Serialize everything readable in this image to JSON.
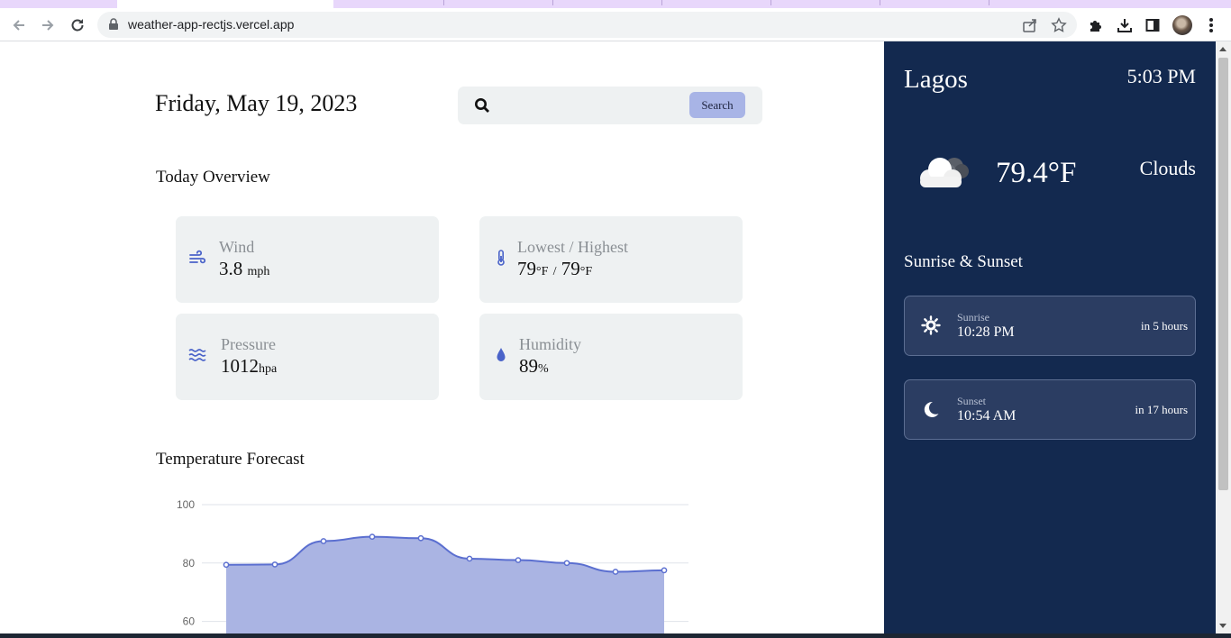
{
  "browser": {
    "url": "weather-app-rectjs.vercel.app"
  },
  "main": {
    "date": "Friday, May 19, 2023",
    "search": {
      "placeholder": "",
      "button_label": "Search"
    },
    "today_overview_title": "Today Overview",
    "cards": {
      "wind": {
        "label": "Wind",
        "value": "3.8",
        "unit": "mph",
        "icon": "wind-icon"
      },
      "low_high": {
        "label": "Lowest / Highest",
        "low": "79",
        "high": "79",
        "unit": "°F",
        "separator": "/",
        "icon": "thermometer-icon"
      },
      "pressure": {
        "label": "Pressure",
        "value": "1012",
        "unit": "hpa",
        "icon": "waves-icon"
      },
      "humidity": {
        "label": "Humidity",
        "value": "89",
        "unit": "%",
        "icon": "droplet-icon"
      }
    },
    "forecast_title": "Temperature Forecast"
  },
  "chart_data": {
    "type": "area",
    "title": "",
    "xlabel": "",
    "ylabel": "",
    "y_ticks": [
      "100",
      "80",
      "60"
    ],
    "ylim": [
      50,
      100
    ],
    "grid": true,
    "color": "#5b6fd0",
    "fill": "#aab4e3",
    "values": [
      79.4,
      79.5,
      87.5,
      89,
      88.5,
      81.5,
      81,
      80,
      77,
      77.5
    ]
  },
  "panel": {
    "city": "Lagos",
    "time": "5:03 PM",
    "temperature": "79.4°F",
    "condition": "Clouds",
    "condition_icon": "cloud-icon",
    "sun_title": "Sunrise & Sunset",
    "sunrise": {
      "label": "Sunrise",
      "time": "10:28 PM",
      "relative": "in 5 hours",
      "icon": "sun-icon"
    },
    "sunset": {
      "label": "Sunset",
      "time": "10:54 AM",
      "relative": "in 17 hours",
      "icon": "moon-icon"
    }
  },
  "colors": {
    "panel_bg": "#13294f",
    "card_bg": "#eef1f2",
    "accent": "#5b6fd0",
    "search_button": "#a8b4e6"
  }
}
